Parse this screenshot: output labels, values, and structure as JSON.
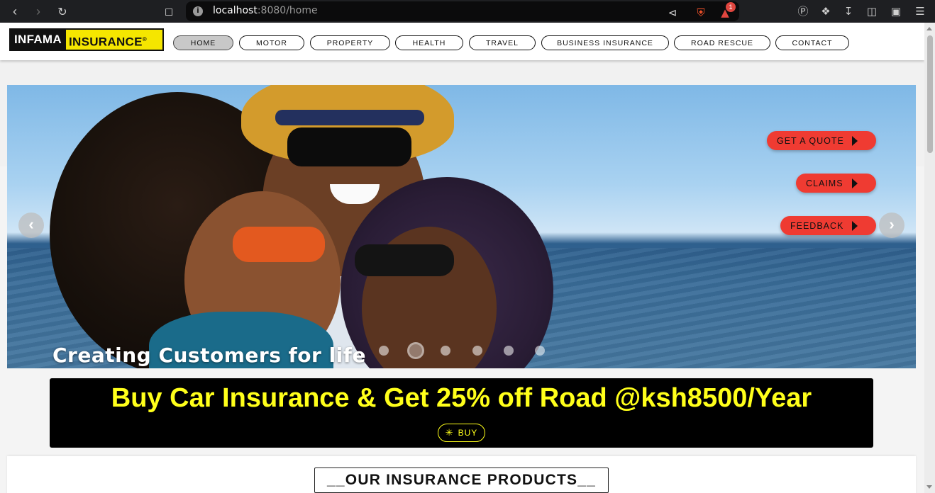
{
  "browser": {
    "url_host": "localhost",
    "url_rest": ":8080/home",
    "notification_count": "1"
  },
  "header": {
    "logo_part1": "INFAMA",
    "logo_part2": "INSURANCE",
    "logo_mark": "®",
    "nav": [
      {
        "label": "HOME",
        "active": true
      },
      {
        "label": "MOTOR"
      },
      {
        "label": "PROPERTY"
      },
      {
        "label": "HEALTH"
      },
      {
        "label": "TRAVEL"
      },
      {
        "label": "BUSINESS INSURANCE"
      },
      {
        "label": "ROAD RESCUE"
      },
      {
        "label": "CONTACT"
      }
    ]
  },
  "hero": {
    "caption": "Creating Customers for life",
    "slide_count": 6,
    "active_slide": 2,
    "prev_arrow": "‹",
    "next_arrow": "›",
    "actions": {
      "quote": "GET A QUOTE",
      "claims": "CLAIMS",
      "feedback": "FEEDBACK"
    }
  },
  "promo": {
    "headline": "Buy Car Insurance & Get 25% off Road @ksh8500/Year",
    "buy_label": "BUY"
  },
  "products": {
    "title": "__OUR INSURANCE PRODUCTS__"
  },
  "colors": {
    "accent_red": "#ef3b32",
    "promo_yellow": "#ffff1a",
    "logo_yellow": "#f5e600"
  }
}
